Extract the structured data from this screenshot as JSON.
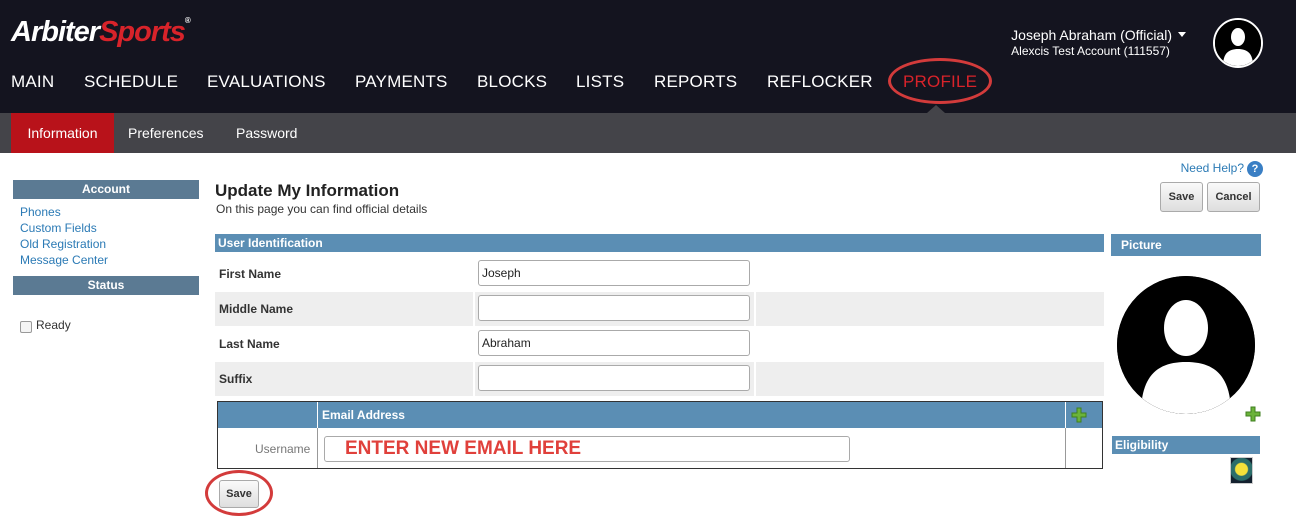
{
  "brand": {
    "part1": "Arbiter",
    "part2": "Sports",
    "tm": "®"
  },
  "user": {
    "name": "Joseph Abraham (Official)",
    "account": "Alexcis Test Account (111557)"
  },
  "main_nav": [
    "MAIN",
    "SCHEDULE",
    "EVALUATIONS",
    "PAYMENTS",
    "BLOCKS",
    "LISTS",
    "REPORTS",
    "REFLOCKER",
    "PROFILE"
  ],
  "sub_nav": [
    "Information",
    "Preferences",
    "Password"
  ],
  "sidebar": {
    "account_heading": "Account",
    "links": [
      "Phones",
      "Custom Fields",
      "Old Registration",
      "Message Center"
    ],
    "status_heading": "Status",
    "ready_label": "Ready"
  },
  "help_text": "Need Help?",
  "page": {
    "title": "Update My Information",
    "subtitle": "On this page you can find official details"
  },
  "buttons": {
    "save": "Save",
    "cancel": "Cancel",
    "save_bottom": "Save"
  },
  "section": {
    "title": "User Identification"
  },
  "fields": [
    {
      "label": "First Name",
      "value": "Joseph"
    },
    {
      "label": "Middle Name",
      "value": ""
    },
    {
      "label": "Last Name",
      "value": "Abraham"
    },
    {
      "label": "Suffix",
      "value": ""
    }
  ],
  "email_table": {
    "header": "Email Address",
    "row_label": "Username",
    "input_text": "ENTER NEW EMAIL HERE"
  },
  "right_panel": {
    "picture_heading": "Picture",
    "eligibility_heading": "Eligibility"
  },
  "colors": {
    "header_bg": "#14141f",
    "subnav_bg": "#444449",
    "active_tab": "#b8121a",
    "section_blue": "#5b8eb4",
    "annotation_red": "#d33b3b"
  }
}
